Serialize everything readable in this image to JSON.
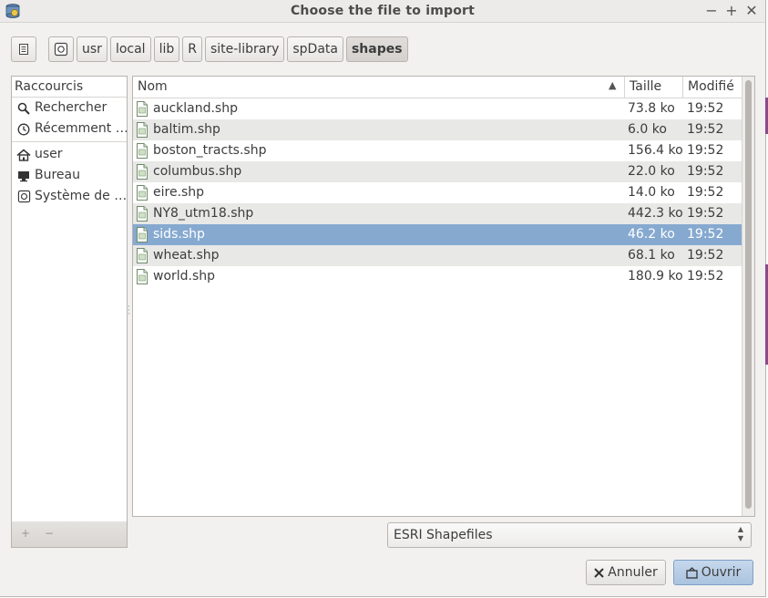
{
  "window": {
    "title": "Choose the file to import",
    "controls": [
      "minimize-icon",
      "maximize-icon",
      "close-icon"
    ]
  },
  "path_bar": {
    "segments": [
      {
        "label": "usr",
        "active": false
      },
      {
        "label": "local",
        "active": false
      },
      {
        "label": "lib",
        "active": false
      },
      {
        "label": "R",
        "active": false
      },
      {
        "label": "site-library",
        "active": false
      },
      {
        "label": "spData",
        "active": false
      },
      {
        "label": "shapes",
        "active": true
      }
    ]
  },
  "places": {
    "header": "Raccourcis",
    "items": [
      {
        "label": "Rechercher",
        "icon": "search-icon"
      },
      {
        "label": "Récemment …",
        "icon": "clock-icon"
      },
      {
        "label": "user",
        "icon": "home-icon"
      },
      {
        "label": "Bureau",
        "icon": "desktop-icon"
      },
      {
        "label": "Système de …",
        "icon": "disk-icon"
      }
    ]
  },
  "files": {
    "columns": {
      "name": "Nom",
      "size": "Taille",
      "modified": "Modifié"
    },
    "selected_index": 6,
    "rows": [
      {
        "name": "auckland.shp",
        "size": "73.8 ko",
        "modified": "19:52"
      },
      {
        "name": "baltim.shp",
        "size": "6.0 ko",
        "modified": "19:52"
      },
      {
        "name": "boston_tracts.shp",
        "size": "156.4 ko",
        "modified": "19:52"
      },
      {
        "name": "columbus.shp",
        "size": "22.0 ko",
        "modified": "19:52"
      },
      {
        "name": "eire.shp",
        "size": "14.0 ko",
        "modified": "19:52"
      },
      {
        "name": "NY8_utm18.shp",
        "size": "442.3 ko",
        "modified": "19:52"
      },
      {
        "name": "sids.shp",
        "size": "46.2 ko",
        "modified": "19:52"
      },
      {
        "name": "wheat.shp",
        "size": "68.1 ko",
        "modified": "19:52"
      },
      {
        "name": "world.shp",
        "size": "180.9 ko",
        "modified": "19:52"
      }
    ]
  },
  "filter": {
    "selected": "ESRI Shapefiles"
  },
  "buttons": {
    "cancel": "Annuler",
    "open": "Ouvrir"
  },
  "colors": {
    "selection": "#86a9d0",
    "window_bg": "#f2f1f0",
    "primary_button": "#a9c3df"
  }
}
